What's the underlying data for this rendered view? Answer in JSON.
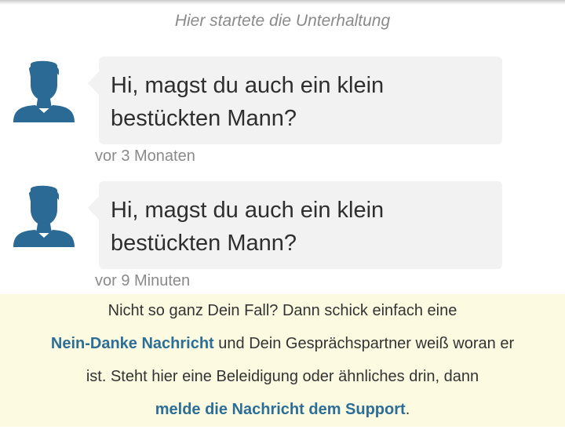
{
  "conversation": {
    "start_label": "Hier startete die Unterhaltung"
  },
  "messages": [
    {
      "line1": "Hi, magst du auch ein klein",
      "line2": "bestückten Mann?",
      "time": "vor 3 Monaten"
    },
    {
      "line1": "Hi, magst du auch ein klein",
      "line2": "bestückten Mann?",
      "time": "vor 9 Minuten"
    }
  ],
  "notice": {
    "line1": "Nicht so ganz Dein Fall? Dann schick einfach eine",
    "link1": "Nein-Danke Nachricht",
    "line2_rest": " und Dein Gesprächspartner weiß woran er",
    "line3": "ist. Steht hier eine Beleidigung oder ähnliches drin, dann",
    "link2": "melde die Nachricht dem Support",
    "line4_rest": "."
  },
  "colors": {
    "avatar": "#2b6a94",
    "link": "#2c6e96",
    "notice_bg": "#fcfbe2",
    "bubble_bg": "#f2f2f2"
  },
  "icons": {
    "avatar": "user-silhouette-icon"
  }
}
